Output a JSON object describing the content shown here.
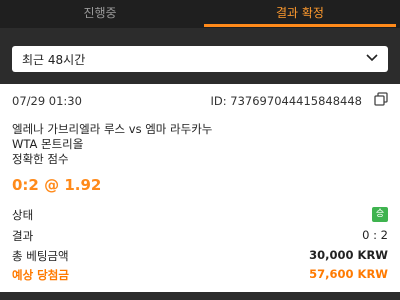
{
  "tabs": {
    "in_progress": "진행중",
    "settled": "결과 확정"
  },
  "filter": {
    "selected": "최근 48시간"
  },
  "bet": {
    "datetime": "07/29 01:30",
    "ticket_id": "ID: 737697044415848448",
    "match": "엘레나 가브리엘라 루스 vs 엠마 라두카누",
    "league": "WTA 몬트리올",
    "market": "정확한 점수",
    "pick": "0:2 @ 1.92",
    "status_label": "상태",
    "status_badge": "승",
    "result_label": "결과",
    "result_value": "0 : 2",
    "stake_label": "총 베팅금액",
    "stake_value": "30,000 KRW",
    "payout_label": "예상 당첨금",
    "payout_value": "57,600 KRW"
  },
  "colors": {
    "accent": "#ff8a1a",
    "win": "#3eb34f"
  }
}
